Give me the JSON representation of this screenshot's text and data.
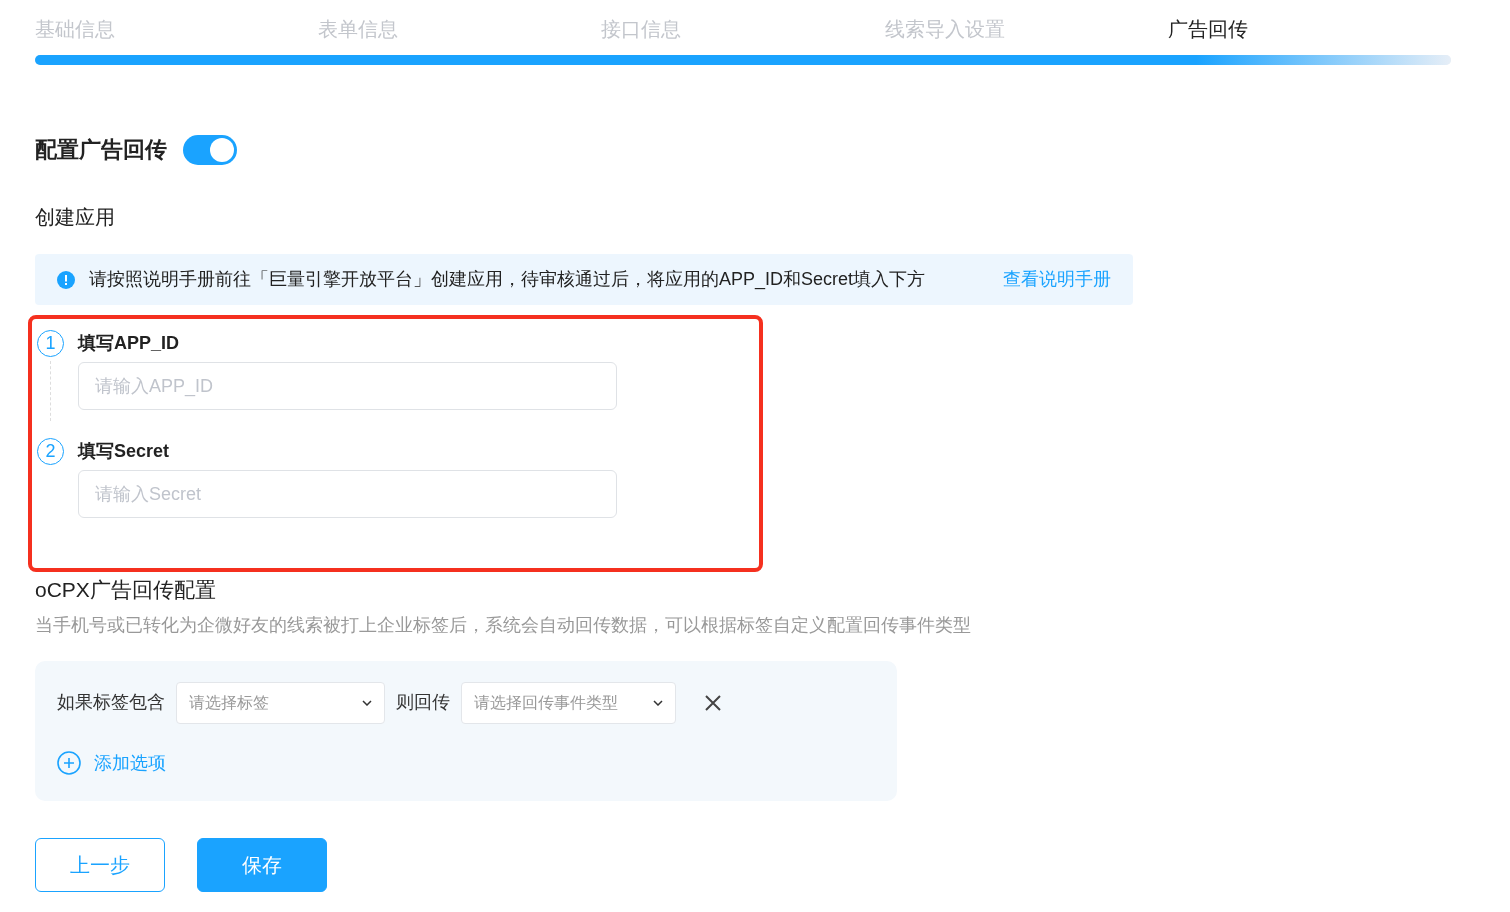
{
  "steps": [
    {
      "label": "基础信息",
      "selected": false
    },
    {
      "label": "表单信息",
      "selected": false
    },
    {
      "label": "接口信息",
      "selected": false
    },
    {
      "label": "线索导入设置",
      "selected": false
    },
    {
      "label": "广告回传",
      "selected": true
    }
  ],
  "progress": {
    "level": 1
  },
  "config": {
    "title": "配置广告回传",
    "on": true
  },
  "create_app": {
    "title": "创建应用",
    "notice": "请按照说明手册前往「巨量引擎开放平台」创建应用，待审核通过后，将应用的APP_ID和Secret填入下方",
    "link": "查看说明手册",
    "fields": [
      {
        "number": "1",
        "label": "填写APP_ID",
        "placeholder": "请输入APP_ID"
      },
      {
        "number": "2",
        "label": "填写Secret",
        "placeholder": "请输入Secret"
      }
    ]
  },
  "ocpx": {
    "title": "oCPX广告回传配置",
    "description": "当手机号或已转化为企微好友的线索被打上企业标签后，系统会自动回传数据，可以根据标签自定义配置回传事件类型",
    "rules": [
      {
        "if_label": "如果标签包含",
        "tag_placeholder": "请选择标签",
        "then_label": "则回传",
        "event_placeholder": "请选择回传事件类型"
      }
    ],
    "add_option": "添加选项"
  },
  "buttons": [
    {
      "label": "上一步",
      "kind": "secondary"
    },
    {
      "label": "保存",
      "kind": "primary"
    }
  ]
}
